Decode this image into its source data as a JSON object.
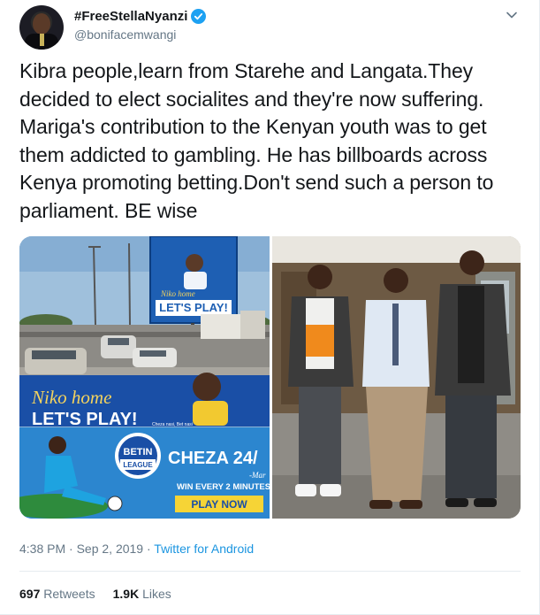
{
  "author": {
    "display_name": "#FreeStellaNyanzi",
    "handle": "@bonifacemwangi",
    "verified": true
  },
  "tweet": {
    "text": "Kibra people,learn from Starehe and Langata.They decided to elect socialites and they're now suffering. Mariga's contribution to the Kenyan youth was to get them addicted to gambling. He has billboards across Kenya promoting betting.Don't send such a person to parliament. BE wise",
    "time": "4:38 PM · Sep 2, 2019",
    "separator": " · ",
    "source": "Twitter for Android"
  },
  "media": {
    "left": {
      "billboard_top": "LET'S PLAY!",
      "billboard_top_script": "Niko home",
      "banner_script": "Niko home",
      "banner_text": "LET'S PLAY!",
      "banner_small": "Cheza nasi, Bet nasi",
      "brand_top": "BETIN",
      "brand_bottom": "LEAGUE",
      "cheza": "CHEZA 24/",
      "cheza_sub": "-Mar",
      "win": "WIN EVERY 2 MINUTES",
      "play_now": "PLAY NOW"
    }
  },
  "stats": {
    "retweets_count": "697",
    "retweets_label": "Retweets",
    "likes_count": "1.9K",
    "likes_label": "Likes"
  },
  "colors": {
    "link": "#1b95e0",
    "verified": "#1da1f2",
    "secondary_text": "#657786"
  },
  "icons": [
    "verified-badge-icon",
    "chevron-down-icon"
  ]
}
